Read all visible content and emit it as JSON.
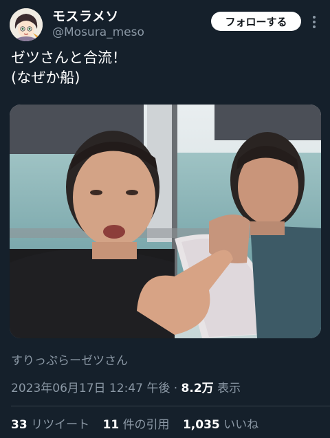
{
  "author": {
    "display_name": "モスラメソ",
    "handle": "@Mosura_meso"
  },
  "follow_button": {
    "label": "フォローする"
  },
  "tweet": {
    "text": "ゼツさんと合流！\n(なぜか船)"
  },
  "source": "すりっぷらーゼツさん",
  "meta": {
    "date_time": "2023年06月17日 12:47 午後",
    "separator": "·",
    "views": "8.2万",
    "views_label": "表示"
  },
  "stats": {
    "retweets": "33",
    "retweets_label": "リツイート",
    "quotes": "11",
    "quotes_label": "件の引用",
    "likes": "1,035",
    "likes_label": "いいね"
  }
}
